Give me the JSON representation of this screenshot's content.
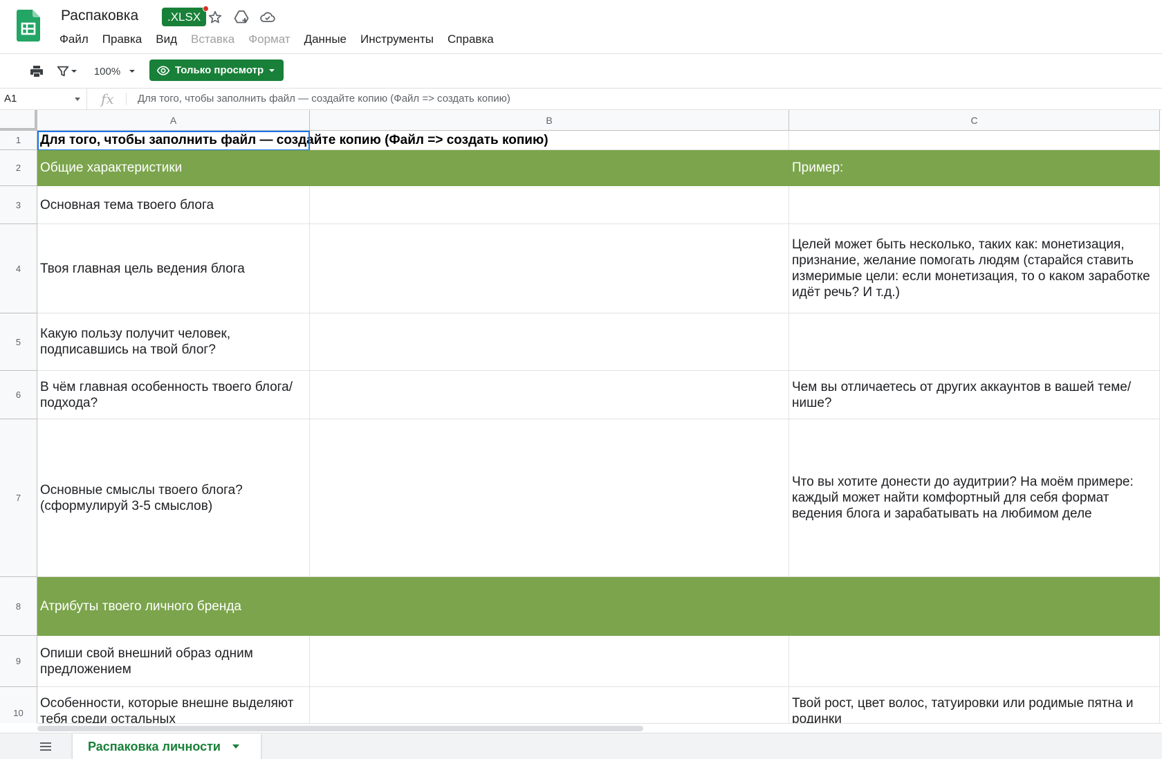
{
  "app": {
    "doc_title": "Распаковка",
    "badge": ".XLSX",
    "icons": [
      "star-icon",
      "drive-add-icon",
      "cloud-status-icon"
    ]
  },
  "menu": [
    {
      "label": "Файл",
      "enabled": true
    },
    {
      "label": "Правка",
      "enabled": true
    },
    {
      "label": "Вид",
      "enabled": true
    },
    {
      "label": "Вставка",
      "enabled": false
    },
    {
      "label": "Формат",
      "enabled": false
    },
    {
      "label": "Данные",
      "enabled": true
    },
    {
      "label": "Инструменты",
      "enabled": true
    },
    {
      "label": "Справка",
      "enabled": true
    }
  ],
  "toolbar": {
    "zoom": "100%",
    "view_only_label": "Только просмотр"
  },
  "formula_bar": {
    "cell_ref": "A1",
    "formula": "Для того, чтобы заполнить файл — создайте копию (Файл => создать копию)"
  },
  "columns": [
    "A",
    "B",
    "C"
  ],
  "rows": [
    {
      "num": "1",
      "a": "Для того, чтобы заполнить файл — создайте копию (Файл => создать копию)",
      "b": "",
      "c": ""
    },
    {
      "num": "2",
      "a": "Общие характеристики",
      "b": "",
      "c": "Пример:"
    },
    {
      "num": "3",
      "a": "Основная тема твоего блога",
      "b": "",
      "c": ""
    },
    {
      "num": "4",
      "a": "Твоя главная цель ведения блога",
      "b": "",
      "c": "Целей может быть несколько, таких как: монетизация, признание, желание помогать людям (старайся ставить измеримые цели: если монетизация, то о каком заработке идёт речь? И т.д.)"
    },
    {
      "num": "5",
      "a": "Какую пользу получит человек, подписавшись на твой блог?",
      "b": "",
      "c": ""
    },
    {
      "num": "6",
      "a": "В чём главная особенность твоего блога/подхода?",
      "b": "",
      "c": "Чем вы отличаетесь от других аккаунтов в вашей теме/нише?"
    },
    {
      "num": "7",
      "a": "Основные смыслы твоего блога? (сформулируй 3-5 смыслов)",
      "b": "",
      "c": "Что вы хотите донести до аудитрии? На моём примере: каждый может найти комфортный для себя формат ведения блога и зарабатывать на любимом деле"
    },
    {
      "num": "8",
      "a": "Атрибуты твоего личного бренда",
      "b": "",
      "c": ""
    },
    {
      "num": "9",
      "a": "Опиши свой внешний образ одним предложением",
      "b": "",
      "c": ""
    },
    {
      "num": "10",
      "a": "Особенности, которые внешне выделяют тебя среди остальных",
      "b": "",
      "c": "Твой рост, цвет волос, татуировки или родимые пятна и родинки"
    }
  ],
  "sheet_tab": {
    "label": "Распаковка личности"
  },
  "colors": {
    "accent": "#188038",
    "section_fill": "#7ba44c",
    "selection": "#1a73e8"
  }
}
